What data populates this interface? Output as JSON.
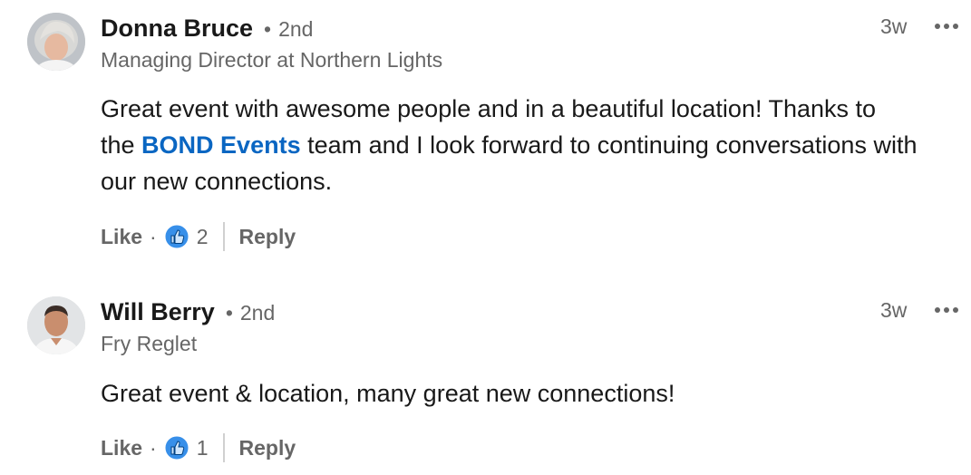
{
  "comments": [
    {
      "author": "Donna Bruce",
      "degree": "2nd",
      "dot": "•",
      "headline": "Managing Director at Northern Lights",
      "time": "3w",
      "text_before": "Great event with awesome people and in a beautiful location! Thanks to",
      "text_line2_prefix": "the ",
      "mention": "BOND Events",
      "text_line2_suffix": " team and I look forward to continuing conversations with",
      "text_line3": "our new connections.",
      "like_label": "Like",
      "action_dot": "·",
      "reaction_count": "2",
      "reply_label": "Reply"
    },
    {
      "author": "Will Berry",
      "degree": "2nd",
      "dot": "•",
      "headline": "Fry Reglet",
      "time": "3w",
      "text_line1": "Great event & location, many great new connections!",
      "like_label": "Like",
      "action_dot": "·",
      "reaction_count": "1",
      "reply_label": "Reply"
    }
  ],
  "colors": {
    "mention": "#0a66c2",
    "muted": "#666666",
    "like_badge": "#378fe9"
  }
}
